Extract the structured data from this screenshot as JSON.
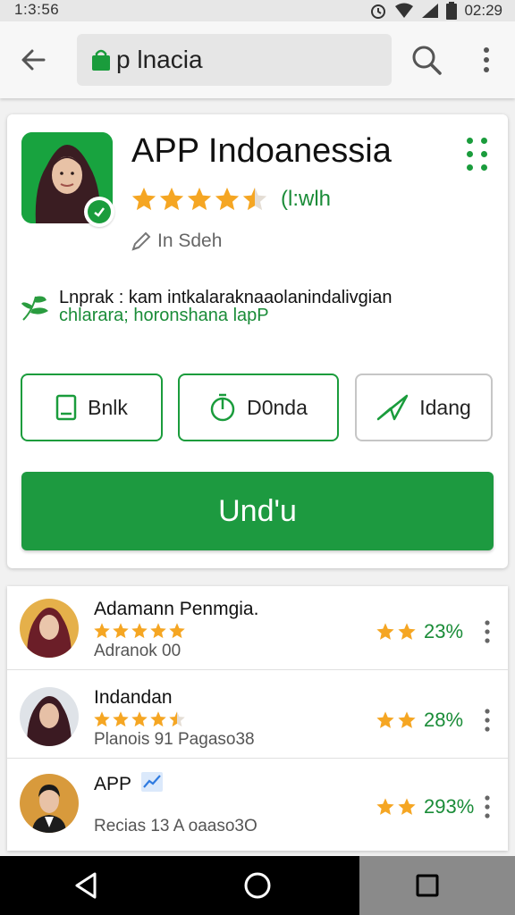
{
  "status_bar": {
    "time": "1:3:56",
    "clock_right": "02:29"
  },
  "app_bar": {
    "search_text": "p lnacia"
  },
  "app": {
    "title": "APP Indoanessia",
    "rating": 4.5,
    "rating_text": "(l:wlh",
    "developer": "In Sdeh",
    "description_line1": "Lnprak :  kam intkalaraknaaolanindalivgian",
    "description_line2": "chlarara;  horonshana lapP"
  },
  "actions": [
    {
      "label": "Bnlk",
      "icon": "book-icon"
    },
    {
      "label": "D0nda",
      "icon": "timer-icon"
    },
    {
      "label": "Idang",
      "icon": "send-icon"
    }
  ],
  "install_label": "Und'u",
  "list": [
    {
      "name": "Adamann Penmgia.",
      "subtitle": "Adranok 00",
      "stars": 5,
      "score_stars": 2,
      "percent": "23%"
    },
    {
      "name": "Indandan",
      "subtitle": "Planois 91 Pagaso38",
      "stars": 4.5,
      "score_stars": 2,
      "percent": "28%"
    },
    {
      "name": "APP",
      "subtitle": "Recias 13 A oaaso3O",
      "stars": 0,
      "score_stars": 2,
      "percent": "293%"
    }
  ],
  "colors": {
    "brand_green": "#1d9a40",
    "star": "#f5a623"
  }
}
